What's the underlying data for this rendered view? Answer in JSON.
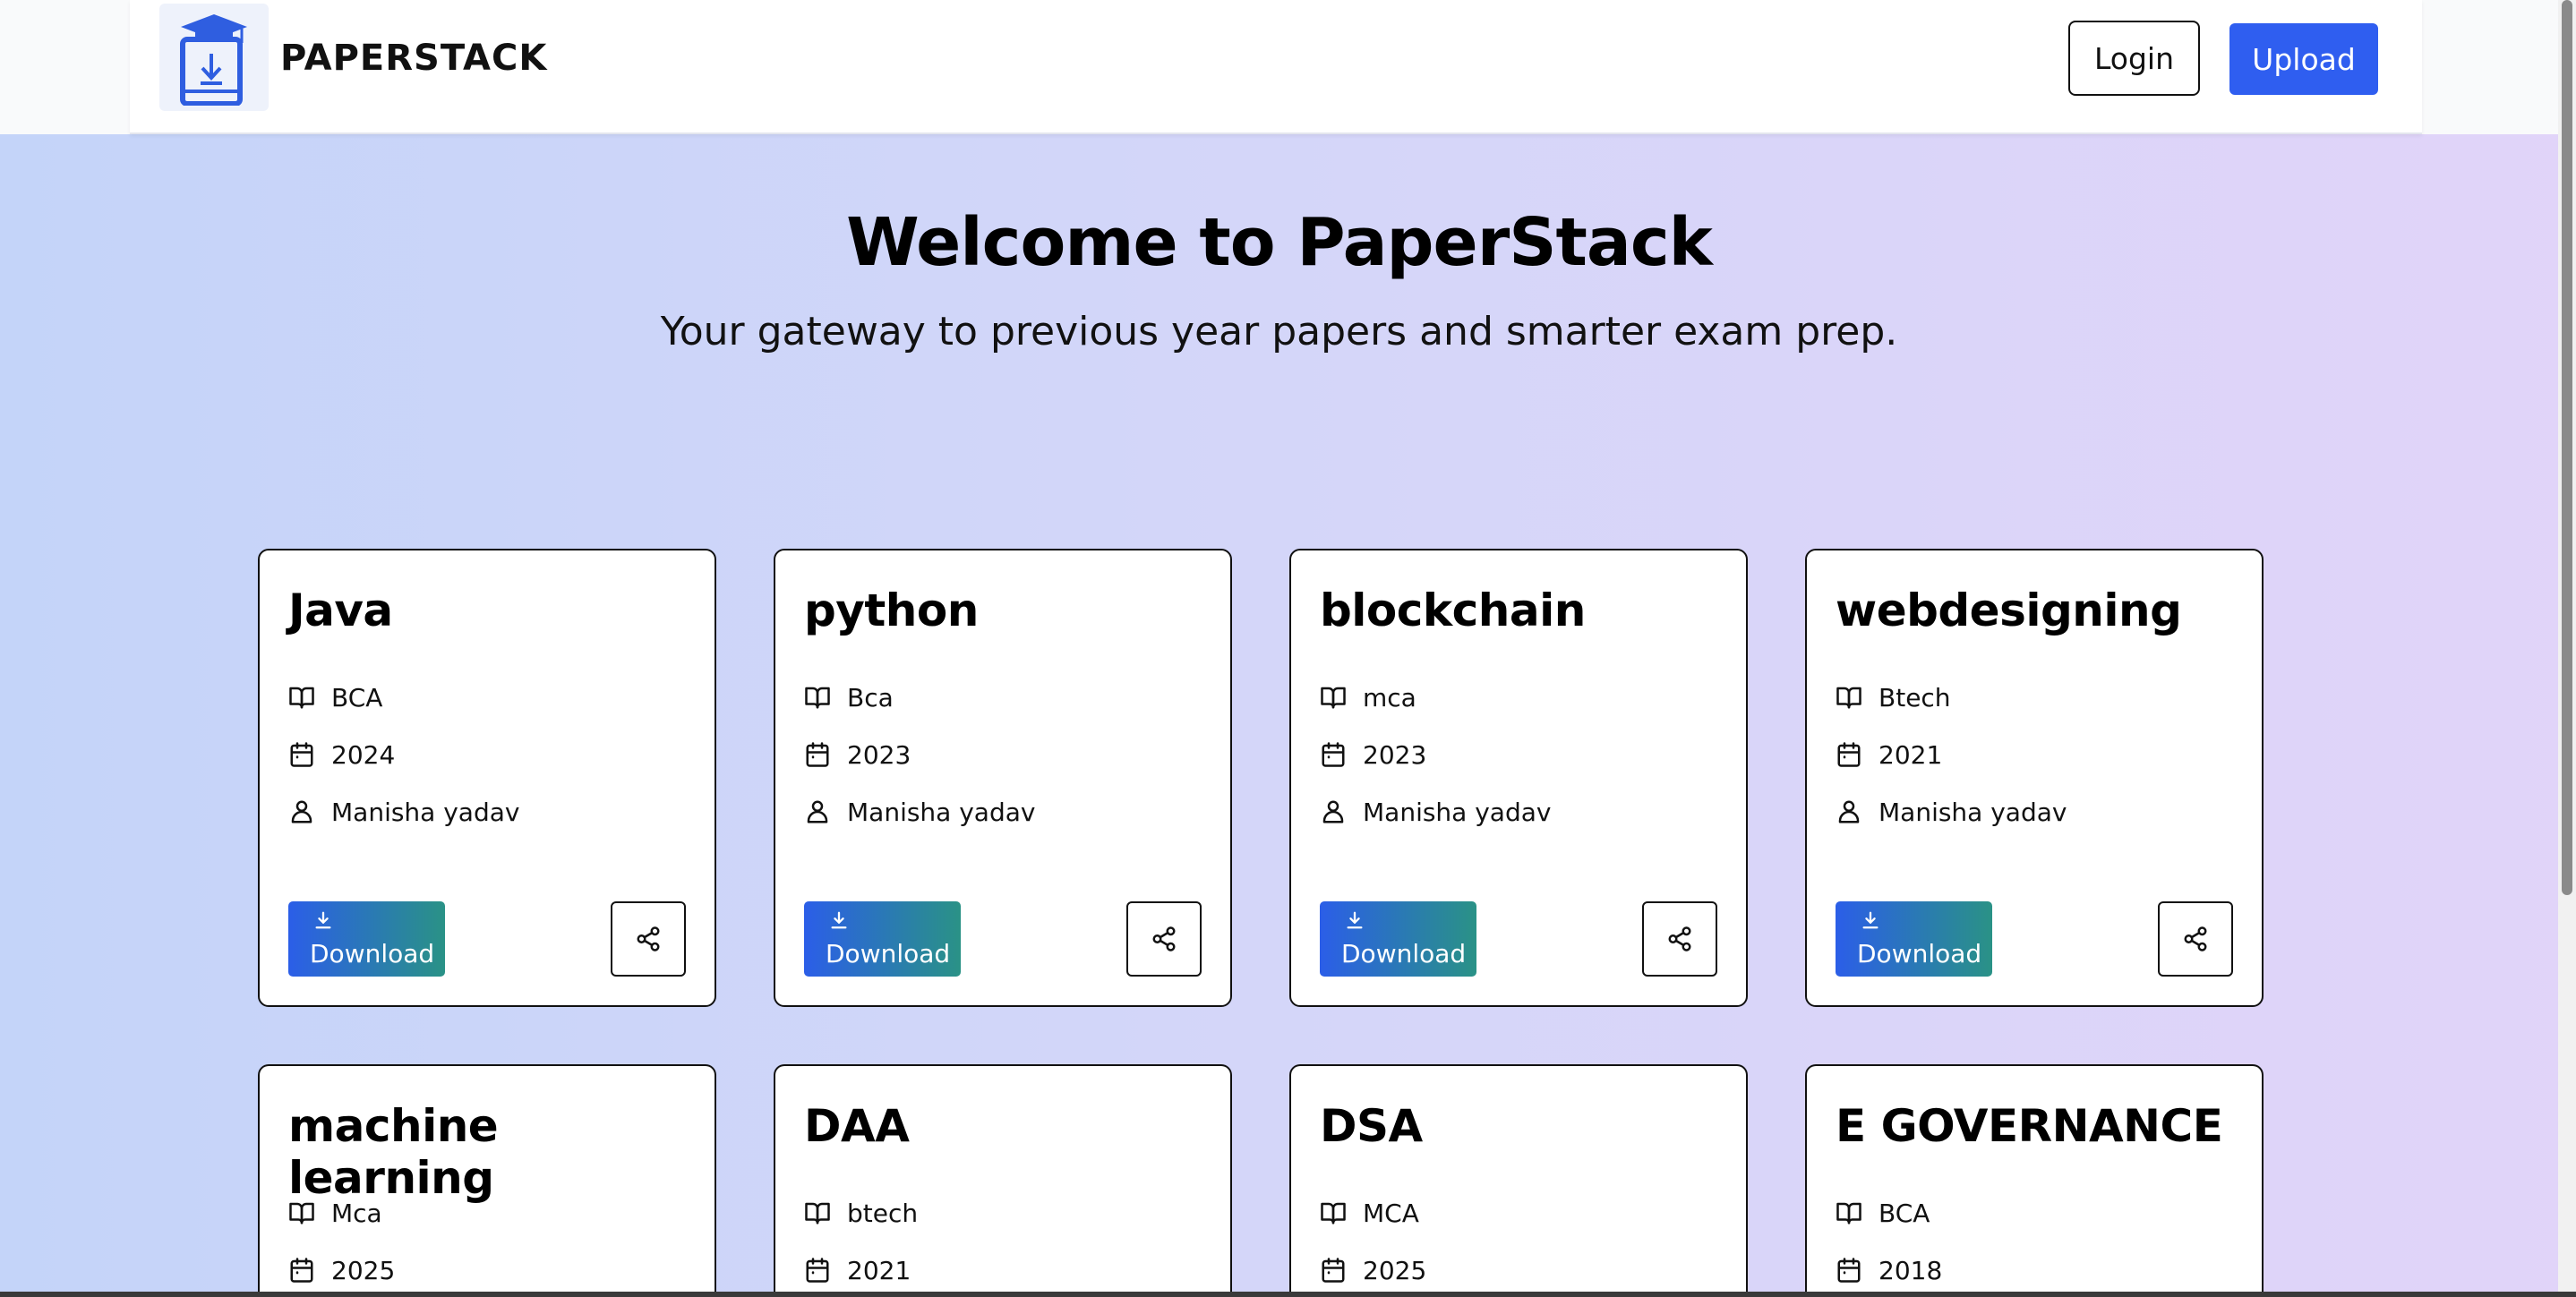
{
  "header": {
    "brand": "PAPERSTACK",
    "login_label": "Login",
    "upload_label": "Upload"
  },
  "hero": {
    "title": "Welcome to PaperStack",
    "subtitle": "Your gateway to previous year papers and smarter exam prep."
  },
  "colors": {
    "accent": "#2f5ef0",
    "download_gradient_start": "#2b5ee8",
    "download_gradient_end": "#2a9286"
  },
  "icons": {
    "course": "book-open-icon",
    "year": "calendar-icon",
    "author": "user-icon",
    "download": "download-icon",
    "share": "share-icon",
    "logo": "graduation-cap-download-icon"
  },
  "papers": [
    {
      "title": "Java",
      "course": "BCA",
      "year": "2024",
      "author": "Manisha yadav",
      "download_label": "Download"
    },
    {
      "title": "python",
      "course": "Bca",
      "year": "2023",
      "author": "Manisha yadav",
      "download_label": "Download"
    },
    {
      "title": "blockchain",
      "course": "mca",
      "year": "2023",
      "author": "Manisha yadav",
      "download_label": "Download"
    },
    {
      "title": "webdesigning",
      "course": "Btech",
      "year": "2021",
      "author": "Manisha yadav",
      "download_label": "Download"
    },
    {
      "title": "machine learning",
      "course": "Mca",
      "year": "2025"
    },
    {
      "title": "DAA",
      "course": "btech",
      "year": "2021"
    },
    {
      "title": "DSA",
      "course": "MCA",
      "year": "2025"
    },
    {
      "title": "E GOVERNANCE",
      "course": "BCA",
      "year": "2018"
    }
  ]
}
